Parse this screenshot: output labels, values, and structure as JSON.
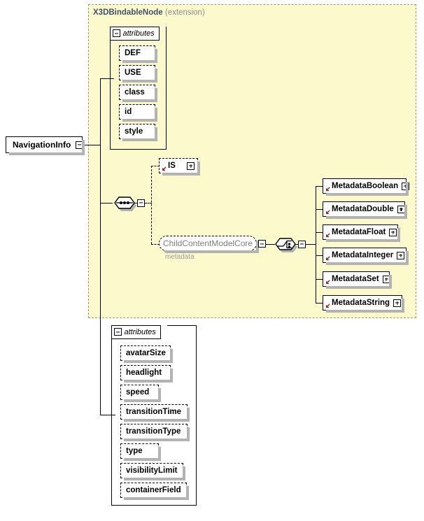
{
  "diagram": {
    "type": "xml-schema-diagram",
    "root_element": {
      "name": "NavigationInfo",
      "toggle": "minus-icon"
    },
    "extension_panel": {
      "base_type": "X3DBindableNode",
      "kind": "(extension)"
    },
    "inherited_attributes_group": {
      "label": "attributes",
      "toggle": "minus-icon",
      "items": [
        {
          "name": "DEF"
        },
        {
          "name": "USE"
        },
        {
          "name": "class"
        },
        {
          "name": "id"
        },
        {
          "name": "style"
        }
      ]
    },
    "content_model": {
      "compositor": "sequence",
      "compositor_toggle": "minus-icon",
      "children": [
        {
          "name": "IS",
          "toggle": "plus-icon",
          "style": "optional-element"
        },
        {
          "name": "ChildContentModelCore",
          "sub_label": "metadata",
          "toggle": "minus-icon",
          "style": "model-group-reference"
        }
      ],
      "inner_compositor": "choice",
      "inner_compositor_toggle": "minus-icon",
      "choice_members": [
        {
          "name": "MetadataBoolean",
          "toggle": "plus-icon"
        },
        {
          "name": "MetadataDouble",
          "toggle": "plus-icon"
        },
        {
          "name": "MetadataFloat",
          "toggle": "plus-icon"
        },
        {
          "name": "MetadataInteger",
          "toggle": "plus-icon"
        },
        {
          "name": "MetadataSet",
          "toggle": "plus-icon"
        },
        {
          "name": "MetadataString",
          "toggle": "plus-icon"
        }
      ]
    },
    "own_attributes_group": {
      "label": "attributes",
      "toggle": "minus-icon",
      "items": [
        {
          "name": "avatarSize"
        },
        {
          "name": "headlight"
        },
        {
          "name": "speed"
        },
        {
          "name": "transitionTime"
        },
        {
          "name": "transitionType"
        },
        {
          "name": "type"
        },
        {
          "name": "visibilityLimit"
        },
        {
          "name": "containerField"
        }
      ]
    },
    "colors": {
      "extension_fill": "#fcfacd",
      "extension_border": "#9a9a7a",
      "base_type_text": "#41506b",
      "kind_text": "#8d8d8d",
      "model_group_text": "#7d7d7d",
      "sub_label_text": "#9b9b9b",
      "shadow": "#b3b3b3",
      "reference_arrow": "#7e2217"
    }
  }
}
